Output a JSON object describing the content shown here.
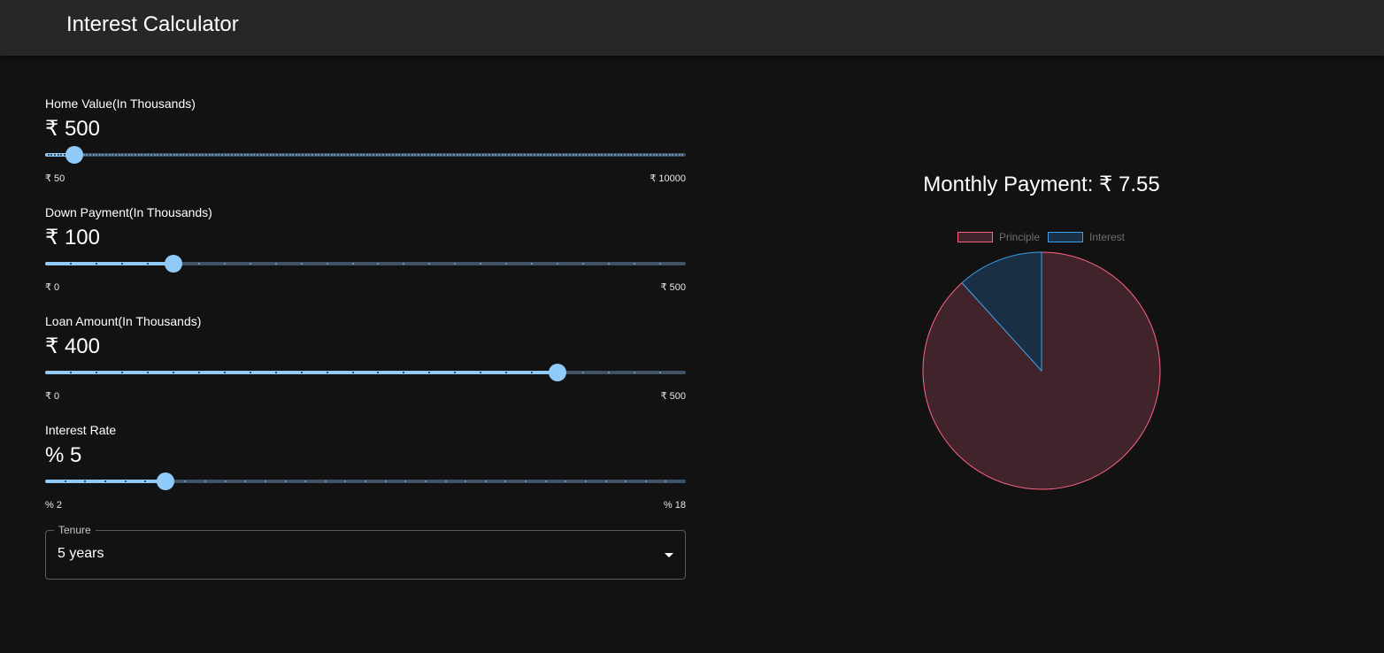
{
  "app": {
    "title": "Interest Calculator"
  },
  "sliders": [
    {
      "label": "Home Value(In Thousands)",
      "value": "₹ 500",
      "min_label": "₹ 50",
      "max_label": "₹ 10000",
      "num_value": 500,
      "min": 50,
      "max": 10000,
      "step": 50
    },
    {
      "label": "Down Payment(In Thousands)",
      "value": "₹ 100",
      "min_label": "₹ 0",
      "max_label": "₹ 500",
      "num_value": 100,
      "min": 0,
      "max": 500,
      "step": 20
    },
    {
      "label": "Loan Amount(In Thousands)",
      "value": "₹ 400",
      "min_label": "₹ 0",
      "max_label": "₹ 500",
      "num_value": 400,
      "min": 0,
      "max": 500,
      "step": 20
    },
    {
      "label": "Interest Rate",
      "value": "% 5",
      "min_label": "% 2",
      "max_label": "% 18",
      "num_value": 5,
      "min": 2,
      "max": 18,
      "step": 0.5
    }
  ],
  "tenure": {
    "label": "Tenure",
    "value": "5 years"
  },
  "colors": {
    "accent": "#90caf9",
    "principle_fill": "#40232b",
    "principle_border": "#ff6384",
    "interest_fill": "#182f44",
    "interest_border": "#36a2eb"
  },
  "chart_data": {
    "type": "pie",
    "title": "Monthly Payment: ₹ 7.55",
    "legend_position": "top",
    "labels": [
      "Principle",
      "Interest"
    ],
    "values": [
      400,
      53
    ]
  }
}
